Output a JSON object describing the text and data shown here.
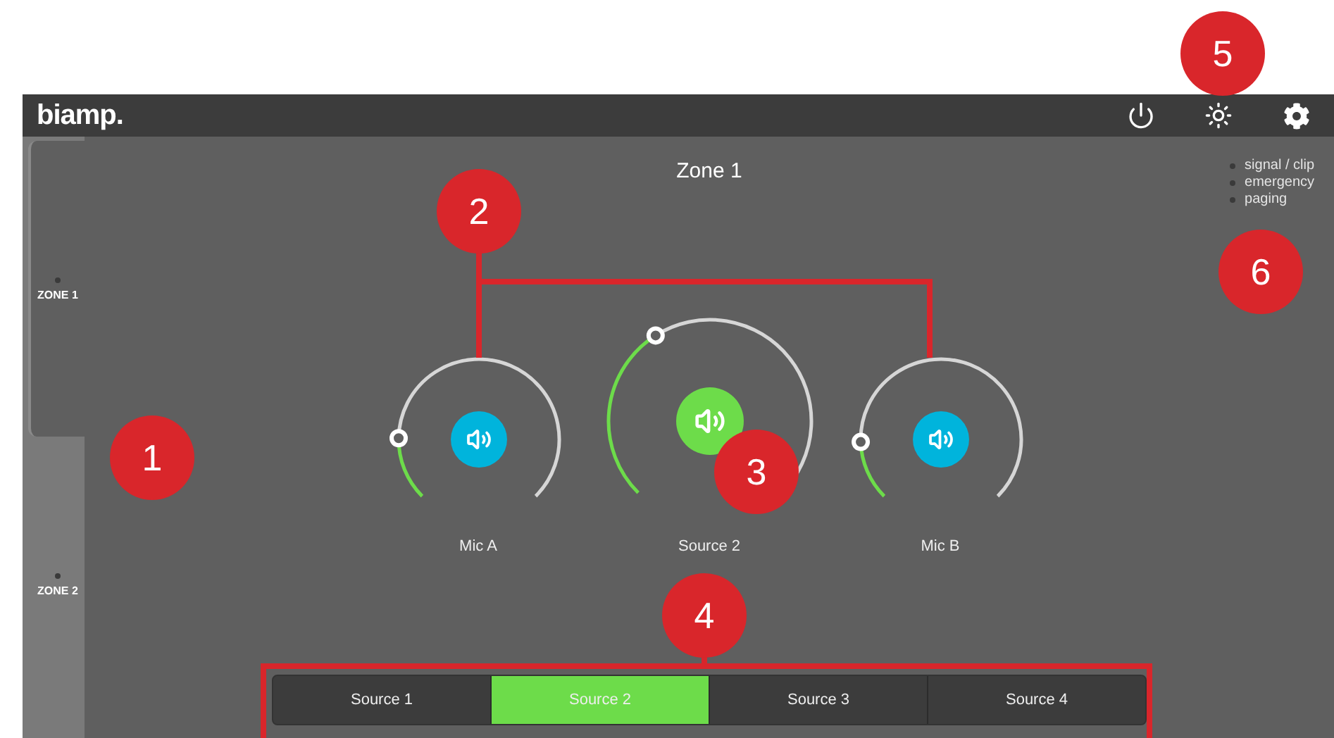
{
  "header": {
    "logo": "biamp."
  },
  "zones": [
    {
      "label": "ZONE 1",
      "selected": true
    },
    {
      "label": "ZONE 2",
      "selected": false
    }
  ],
  "zone_title": "Zone 1",
  "legend": [
    "signal / clip",
    "emergency",
    "paging"
  ],
  "channels": [
    {
      "name": "Mic A",
      "kind": "mic",
      "selected": false
    },
    {
      "name": "Source 2",
      "kind": "source",
      "selected": true
    },
    {
      "name": "Mic B",
      "kind": "mic",
      "selected": false
    }
  ],
  "sources": [
    {
      "label": "Source 1",
      "selected": false
    },
    {
      "label": "Source 2",
      "selected": true
    },
    {
      "label": "Source 3",
      "selected": false
    },
    {
      "label": "Source 4",
      "selected": false
    }
  ],
  "callouts": [
    "1",
    "2",
    "3",
    "4",
    "5",
    "6"
  ]
}
